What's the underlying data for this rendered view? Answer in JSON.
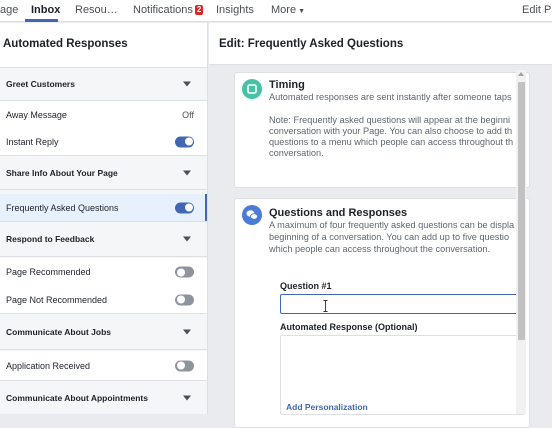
{
  "topnav": {
    "tabs": [
      {
        "label": "age"
      },
      {
        "label": "Inbox"
      },
      {
        "label": "Resou…"
      },
      {
        "label": "Notifications",
        "badge": "2"
      },
      {
        "label": "Insights"
      },
      {
        "label": "More"
      },
      {
        "label": "Edit Pa"
      }
    ]
  },
  "sidebar": {
    "header": "Automated Responses",
    "items": [
      {
        "label": "Greet Customers"
      },
      {
        "label": "Away Message",
        "value": "Off"
      },
      {
        "label": "Instant Reply",
        "toggle": "on"
      },
      {
        "label": "Share Info About Your Page"
      },
      {
        "label": "Frequently Asked Questions",
        "toggle": "on"
      },
      {
        "label": "Respond to Feedback"
      },
      {
        "label": "Page Recommended",
        "toggle": "off"
      },
      {
        "label": "Page Not Recommended",
        "toggle": "off"
      },
      {
        "label": "Communicate About Jobs"
      },
      {
        "label": "Application Received",
        "toggle": "off"
      },
      {
        "label": "Communicate About Appointments"
      }
    ]
  },
  "main": {
    "header": "Edit: Frequently Asked Questions",
    "timing": {
      "title": "Timing",
      "lines": [
        "Automated responses are sent instantly after someone taps",
        "Note: Frequently asked questions will appear at the beginni",
        "conversation with your Page. You can also choose to add th",
        "questions to a menu which people can access throughout th",
        "conversation."
      ]
    },
    "qa": {
      "title": "Questions and Responses",
      "lines": [
        "A maximum of four frequently asked questions can be displa",
        "beginning of a conversation. You can add up to five questio",
        "which people can access throughout the conversation."
      ],
      "question_label": "Question #1",
      "question_value": "",
      "response_label": "Automated Response (Optional)",
      "response_value": "",
      "add_personalization": "Add Personalization"
    }
  },
  "colors": {
    "accent": "#4267b2",
    "timing_icon": "#46c2a5",
    "qa_icon": "#4a7bd5",
    "badge": "#e02424"
  }
}
